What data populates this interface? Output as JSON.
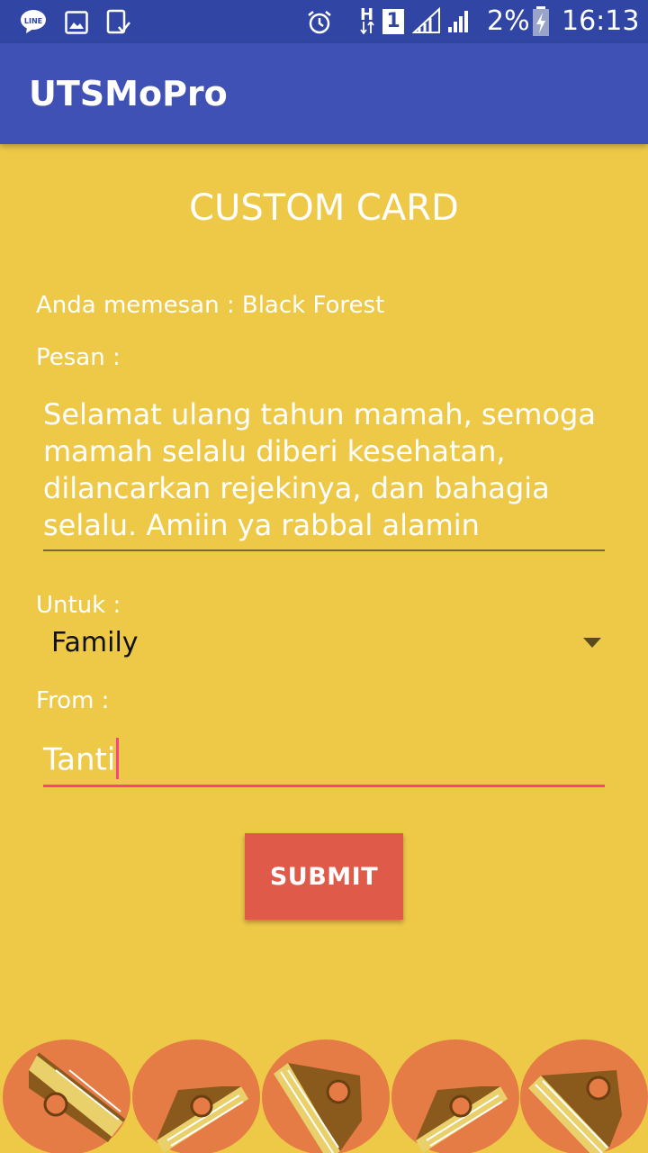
{
  "status_bar": {
    "time": "16:13",
    "battery": "2%",
    "sim_slot": "1",
    "network": "H",
    "icons": [
      "line-icon",
      "image-icon",
      "clipboard-check-icon",
      "alarm-icon",
      "data-arrows-icon",
      "signal-icon",
      "signal-icon",
      "battery-charging-icon"
    ]
  },
  "app_bar": {
    "title": "UTSMoPro"
  },
  "screen": {
    "title": "CUSTOM CARD",
    "order_text": "Anda memesan : Black Forest",
    "message_label": "Pesan :",
    "message_value": "Selamat ulang tahun mamah, semoga mamah selalu diberi kesehatan, dilancarkan rejekinya, dan bahagia selalu. Amiin ya rabbal alamin",
    "for_label": "Untuk :",
    "for_selected": "Family",
    "from_label": "From :",
    "from_value": "Tanti",
    "submit_label": "SUBMIT"
  },
  "cake_images": [
    "cake-slice-icon",
    "cake-slice-icon",
    "cake-slice-icon",
    "cake-slice-icon",
    "cake-slice-icon"
  ],
  "colors": {
    "status_bar": "#3146A4",
    "app_bar": "#3F51B5",
    "background": "#EEC948",
    "accent": "#FF4081",
    "button": "#E05A4A"
  }
}
